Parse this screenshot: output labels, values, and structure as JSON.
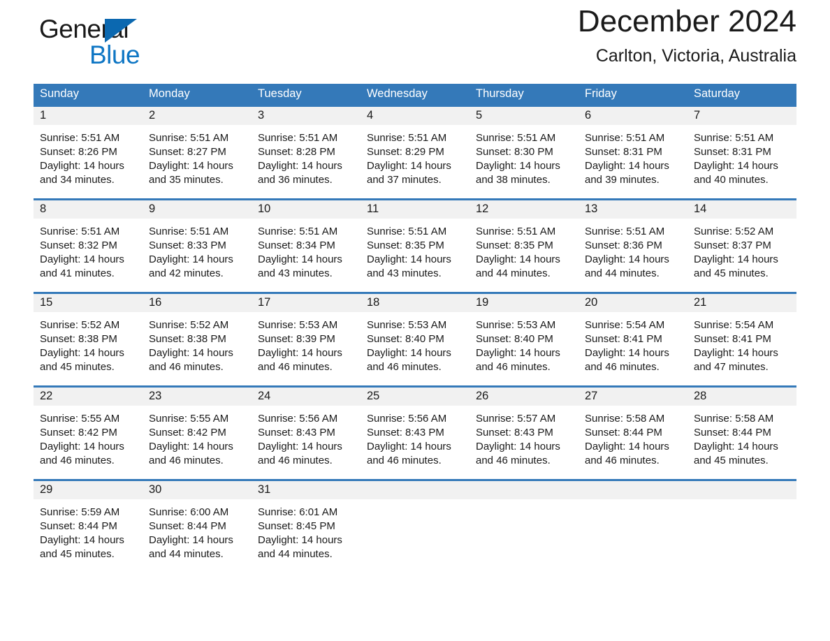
{
  "brand": {
    "word_one": "General",
    "word_two": "Blue",
    "triangle_color": "#0b68b0",
    "blue_color": "#0e76c4"
  },
  "header": {
    "title": "December 2024",
    "subtitle": "Carlton, Victoria, Australia"
  },
  "theme": {
    "header_blue": "#3479b9",
    "daynum_band": "#f1f1f1",
    "text": "#1a1a1a"
  },
  "calendar": {
    "weekdays": [
      "Sunday",
      "Monday",
      "Tuesday",
      "Wednesday",
      "Thursday",
      "Friday",
      "Saturday"
    ],
    "weeks": [
      [
        {
          "day": "1",
          "sunrise": "Sunrise: 5:51 AM",
          "sunset": "Sunset: 8:26 PM",
          "daylight1": "Daylight: 14 hours",
          "daylight2": "and 34 minutes."
        },
        {
          "day": "2",
          "sunrise": "Sunrise: 5:51 AM",
          "sunset": "Sunset: 8:27 PM",
          "daylight1": "Daylight: 14 hours",
          "daylight2": "and 35 minutes."
        },
        {
          "day": "3",
          "sunrise": "Sunrise: 5:51 AM",
          "sunset": "Sunset: 8:28 PM",
          "daylight1": "Daylight: 14 hours",
          "daylight2": "and 36 minutes."
        },
        {
          "day": "4",
          "sunrise": "Sunrise: 5:51 AM",
          "sunset": "Sunset: 8:29 PM",
          "daylight1": "Daylight: 14 hours",
          "daylight2": "and 37 minutes."
        },
        {
          "day": "5",
          "sunrise": "Sunrise: 5:51 AM",
          "sunset": "Sunset: 8:30 PM",
          "daylight1": "Daylight: 14 hours",
          "daylight2": "and 38 minutes."
        },
        {
          "day": "6",
          "sunrise": "Sunrise: 5:51 AM",
          "sunset": "Sunset: 8:31 PM",
          "daylight1": "Daylight: 14 hours",
          "daylight2": "and 39 minutes."
        },
        {
          "day": "7",
          "sunrise": "Sunrise: 5:51 AM",
          "sunset": "Sunset: 8:31 PM",
          "daylight1": "Daylight: 14 hours",
          "daylight2": "and 40 minutes."
        }
      ],
      [
        {
          "day": "8",
          "sunrise": "Sunrise: 5:51 AM",
          "sunset": "Sunset: 8:32 PM",
          "daylight1": "Daylight: 14 hours",
          "daylight2": "and 41 minutes."
        },
        {
          "day": "9",
          "sunrise": "Sunrise: 5:51 AM",
          "sunset": "Sunset: 8:33 PM",
          "daylight1": "Daylight: 14 hours",
          "daylight2": "and 42 minutes."
        },
        {
          "day": "10",
          "sunrise": "Sunrise: 5:51 AM",
          "sunset": "Sunset: 8:34 PM",
          "daylight1": "Daylight: 14 hours",
          "daylight2": "and 43 minutes."
        },
        {
          "day": "11",
          "sunrise": "Sunrise: 5:51 AM",
          "sunset": "Sunset: 8:35 PM",
          "daylight1": "Daylight: 14 hours",
          "daylight2": "and 43 minutes."
        },
        {
          "day": "12",
          "sunrise": "Sunrise: 5:51 AM",
          "sunset": "Sunset: 8:35 PM",
          "daylight1": "Daylight: 14 hours",
          "daylight2": "and 44 minutes."
        },
        {
          "day": "13",
          "sunrise": "Sunrise: 5:51 AM",
          "sunset": "Sunset: 8:36 PM",
          "daylight1": "Daylight: 14 hours",
          "daylight2": "and 44 minutes."
        },
        {
          "day": "14",
          "sunrise": "Sunrise: 5:52 AM",
          "sunset": "Sunset: 8:37 PM",
          "daylight1": "Daylight: 14 hours",
          "daylight2": "and 45 minutes."
        }
      ],
      [
        {
          "day": "15",
          "sunrise": "Sunrise: 5:52 AM",
          "sunset": "Sunset: 8:38 PM",
          "daylight1": "Daylight: 14 hours",
          "daylight2": "and 45 minutes."
        },
        {
          "day": "16",
          "sunrise": "Sunrise: 5:52 AM",
          "sunset": "Sunset: 8:38 PM",
          "daylight1": "Daylight: 14 hours",
          "daylight2": "and 46 minutes."
        },
        {
          "day": "17",
          "sunrise": "Sunrise: 5:53 AM",
          "sunset": "Sunset: 8:39 PM",
          "daylight1": "Daylight: 14 hours",
          "daylight2": "and 46 minutes."
        },
        {
          "day": "18",
          "sunrise": "Sunrise: 5:53 AM",
          "sunset": "Sunset: 8:40 PM",
          "daylight1": "Daylight: 14 hours",
          "daylight2": "and 46 minutes."
        },
        {
          "day": "19",
          "sunrise": "Sunrise: 5:53 AM",
          "sunset": "Sunset: 8:40 PM",
          "daylight1": "Daylight: 14 hours",
          "daylight2": "and 46 minutes."
        },
        {
          "day": "20",
          "sunrise": "Sunrise: 5:54 AM",
          "sunset": "Sunset: 8:41 PM",
          "daylight1": "Daylight: 14 hours",
          "daylight2": "and 46 minutes."
        },
        {
          "day": "21",
          "sunrise": "Sunrise: 5:54 AM",
          "sunset": "Sunset: 8:41 PM",
          "daylight1": "Daylight: 14 hours",
          "daylight2": "and 47 minutes."
        }
      ],
      [
        {
          "day": "22",
          "sunrise": "Sunrise: 5:55 AM",
          "sunset": "Sunset: 8:42 PM",
          "daylight1": "Daylight: 14 hours",
          "daylight2": "and 46 minutes."
        },
        {
          "day": "23",
          "sunrise": "Sunrise: 5:55 AM",
          "sunset": "Sunset: 8:42 PM",
          "daylight1": "Daylight: 14 hours",
          "daylight2": "and 46 minutes."
        },
        {
          "day": "24",
          "sunrise": "Sunrise: 5:56 AM",
          "sunset": "Sunset: 8:43 PM",
          "daylight1": "Daylight: 14 hours",
          "daylight2": "and 46 minutes."
        },
        {
          "day": "25",
          "sunrise": "Sunrise: 5:56 AM",
          "sunset": "Sunset: 8:43 PM",
          "daylight1": "Daylight: 14 hours",
          "daylight2": "and 46 minutes."
        },
        {
          "day": "26",
          "sunrise": "Sunrise: 5:57 AM",
          "sunset": "Sunset: 8:43 PM",
          "daylight1": "Daylight: 14 hours",
          "daylight2": "and 46 minutes."
        },
        {
          "day": "27",
          "sunrise": "Sunrise: 5:58 AM",
          "sunset": "Sunset: 8:44 PM",
          "daylight1": "Daylight: 14 hours",
          "daylight2": "and 46 minutes."
        },
        {
          "day": "28",
          "sunrise": "Sunrise: 5:58 AM",
          "sunset": "Sunset: 8:44 PM",
          "daylight1": "Daylight: 14 hours",
          "daylight2": "and 45 minutes."
        }
      ],
      [
        {
          "day": "29",
          "sunrise": "Sunrise: 5:59 AM",
          "sunset": "Sunset: 8:44 PM",
          "daylight1": "Daylight: 14 hours",
          "daylight2": "and 45 minutes."
        },
        {
          "day": "30",
          "sunrise": "Sunrise: 6:00 AM",
          "sunset": "Sunset: 8:44 PM",
          "daylight1": "Daylight: 14 hours",
          "daylight2": "and 44 minutes."
        },
        {
          "day": "31",
          "sunrise": "Sunrise: 6:01 AM",
          "sunset": "Sunset: 8:45 PM",
          "daylight1": "Daylight: 14 hours",
          "daylight2": "and 44 minutes."
        },
        {
          "day": "",
          "sunrise": "",
          "sunset": "",
          "daylight1": "",
          "daylight2": ""
        },
        {
          "day": "",
          "sunrise": "",
          "sunset": "",
          "daylight1": "",
          "daylight2": ""
        },
        {
          "day": "",
          "sunrise": "",
          "sunset": "",
          "daylight1": "",
          "daylight2": ""
        },
        {
          "day": "",
          "sunrise": "",
          "sunset": "",
          "daylight1": "",
          "daylight2": ""
        }
      ]
    ]
  }
}
